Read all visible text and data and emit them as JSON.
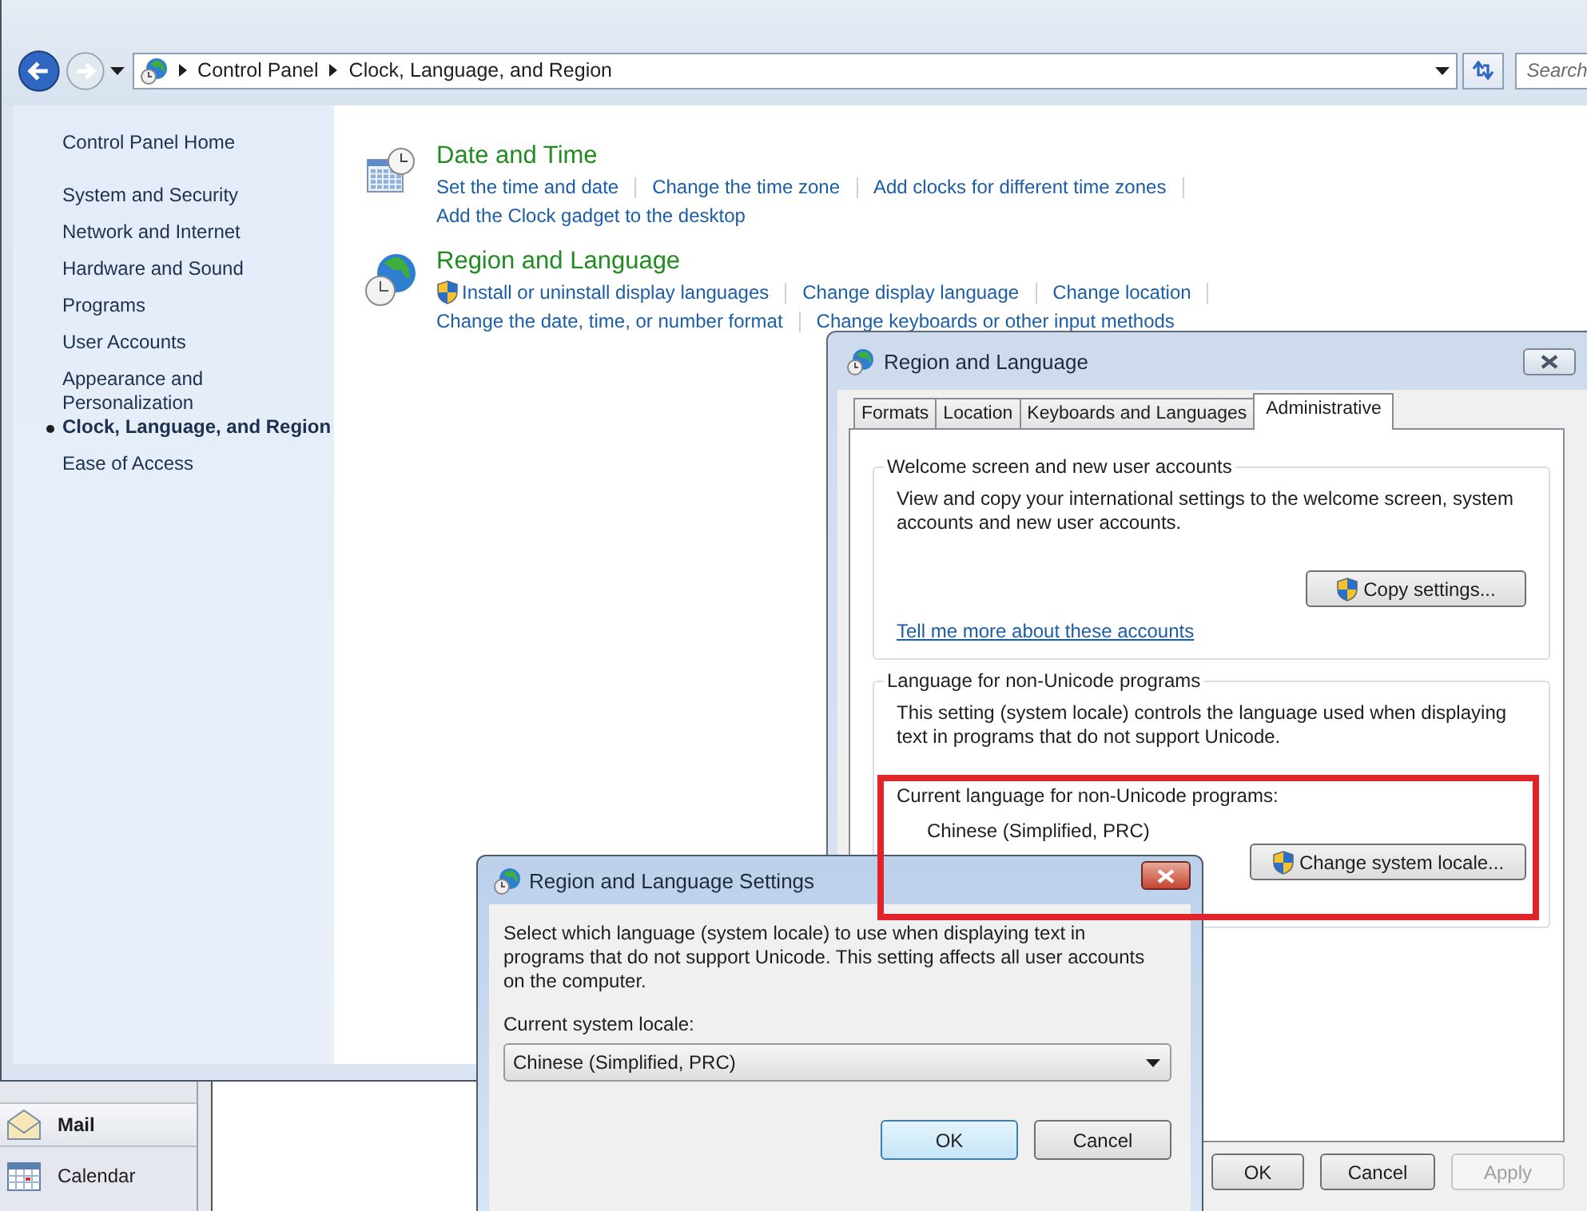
{
  "explorer": {
    "breadcrumbs": [
      "Control Panel",
      "Clock, Language, and Region"
    ],
    "search": {
      "placeholder": "Search"
    },
    "sidebar": {
      "home": "Control Panel Home",
      "items": [
        {
          "label": "System and Security",
          "selected": false
        },
        {
          "label": "Network and Internet",
          "selected": false
        },
        {
          "label": "Hardware and Sound",
          "selected": false
        },
        {
          "label": "Programs",
          "selected": false
        },
        {
          "label": "User Accounts",
          "selected": false
        },
        {
          "label": "Appearance and Personalization",
          "selected": false
        },
        {
          "label": "Clock, Language, and Region",
          "selected": true
        },
        {
          "label": "Ease of Access",
          "selected": false
        }
      ]
    },
    "categories": [
      {
        "title": "Date and Time",
        "lines": [
          [
            {
              "label": "Set the time and date",
              "shield": false
            },
            {
              "label": "Change the time zone",
              "shield": false
            },
            {
              "label": "Add clocks for different time zones",
              "shield": false
            }
          ],
          [
            {
              "label": "Add the Clock gadget to the desktop",
              "shield": false
            }
          ]
        ]
      },
      {
        "title": "Region and Language",
        "lines": [
          [
            {
              "label": "Install or uninstall display languages",
              "shield": true
            },
            {
              "label": "Change display language",
              "shield": false
            },
            {
              "label": "Change location",
              "shield": false
            }
          ],
          [
            {
              "label": "Change the date, time, or number format",
              "shield": false
            },
            {
              "label": "Change keyboards or other input methods",
              "shield": false
            }
          ]
        ]
      }
    ]
  },
  "outlook": {
    "items": [
      {
        "label": "Mail",
        "selected": true
      },
      {
        "label": "Calendar",
        "selected": false
      }
    ]
  },
  "region_dialog": {
    "title": "Region and Language",
    "tabs": [
      {
        "label": "Formats",
        "selected": false
      },
      {
        "label": "Location",
        "selected": false
      },
      {
        "label": "Keyboards and Languages",
        "selected": false
      },
      {
        "label": "Administrative",
        "selected": true
      }
    ],
    "welcome": {
      "title": "Welcome screen and new user accounts",
      "text": "View and copy your international settings to the welcome screen, system accounts and new user accounts.",
      "button": "Copy settings...",
      "link": "Tell me more about these accounts"
    },
    "non_unicode": {
      "title": "Language for non-Unicode programs",
      "text": "This setting (system locale) controls the language used when displaying text in programs that do not support Unicode.",
      "current_label": "Current language for non-Unicode programs:",
      "current_value": "Chinese (Simplified, PRC)",
      "button": "Change system locale..."
    },
    "buttons": [
      {
        "label": "OK",
        "disabled": false
      },
      {
        "label": "Cancel",
        "disabled": false
      },
      {
        "label": "Apply",
        "disabled": true
      }
    ]
  },
  "settings_dialog": {
    "title": "Region and Language Settings",
    "text": "Select which language (system locale) to use when displaying text in programs that do not support Unicode. This setting affects all user accounts on the computer.",
    "locale_label": "Current system locale:",
    "locale_value": "Chinese (Simplified, PRC)",
    "buttons": [
      {
        "label": "OK",
        "default": true
      },
      {
        "label": "Cancel",
        "default": false
      }
    ]
  }
}
